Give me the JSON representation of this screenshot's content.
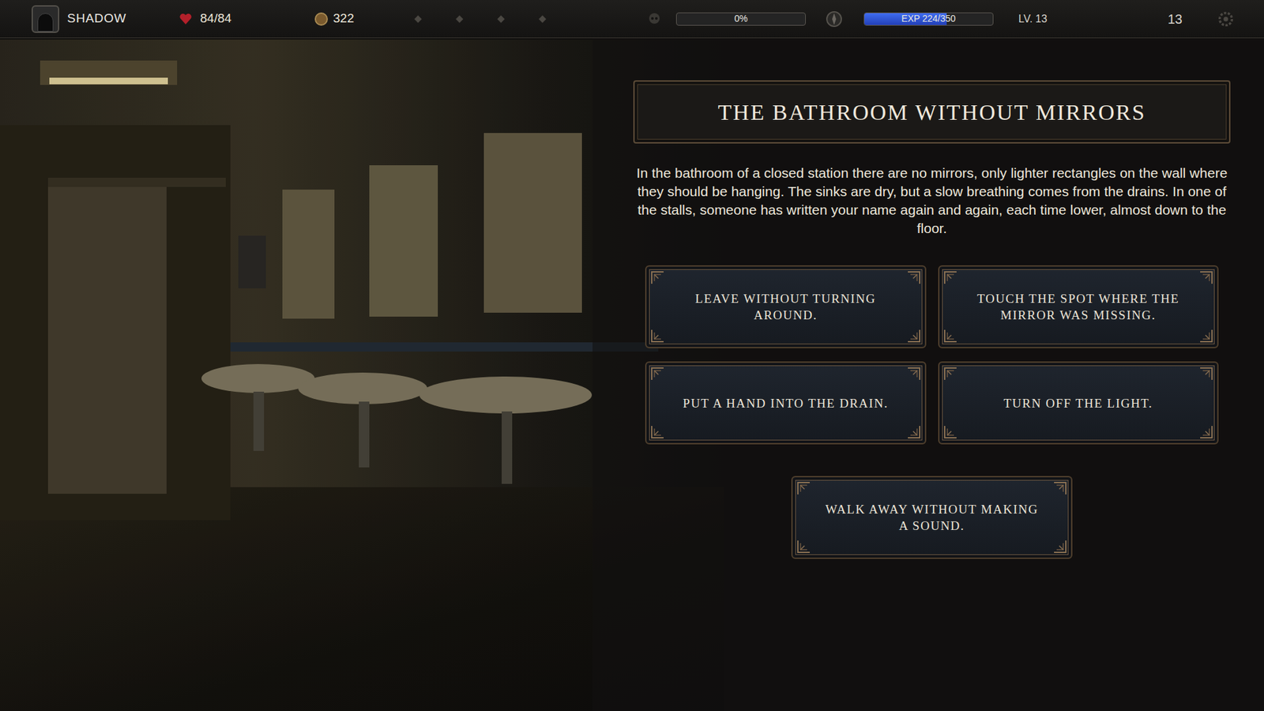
{
  "hud": {
    "name": "SHADOW",
    "health": "84/84",
    "gold": "322",
    "progress": {
      "reading": "0%",
      "level": 0
    },
    "exp": {
      "reading": "EXP 224/350",
      "level": 0.64
    },
    "level_label": "LV. 13",
    "counter": "13"
  },
  "event": {
    "title": "THE BATHROOM WITHOUT MIRRORS",
    "description": "In the bathroom of a closed station there are no mirrors, only lighter rectangles on the wall where they should be hanging. The sinks are dry, but a slow breathing comes from the drains. In one of the stalls, someone has written your name again and again, each time lower, almost down to the floor.",
    "choices": [
      {
        "label": "LEAVE WITHOUT TURNING AROUND."
      },
      {
        "label": "TOUCH THE SPOT WHERE THE MIRROR WAS MISSING."
      },
      {
        "label": "PUT A HAND INTO THE DRAIN."
      },
      {
        "label": "TURN OFF THE LIGHT."
      },
      {
        "label": "WALK AWAY WITHOUT MAKING A SOUND."
      }
    ]
  }
}
